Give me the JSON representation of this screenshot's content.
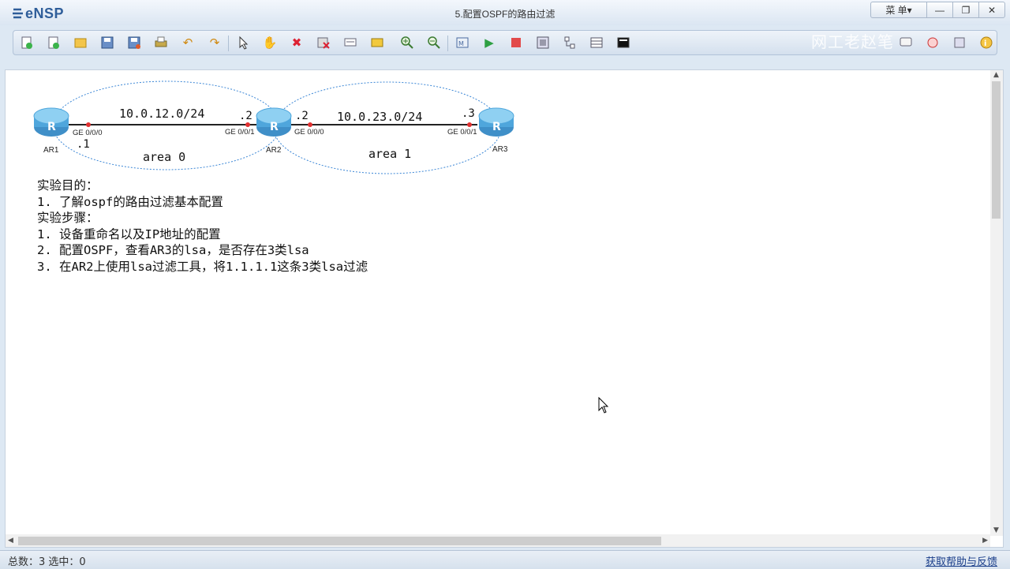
{
  "app": {
    "logo": "eNSP",
    "window_title": "5.配置OSPF的路由过滤",
    "menu_label": "菜 单▾",
    "minimize": "—",
    "restore": "❐",
    "close": "✕"
  },
  "watermark": "网工老赵笔",
  "toolbar": {
    "buttons": [
      "new-topology",
      "new-topology-alt",
      "open",
      "save",
      "save-as",
      "print",
      "undo",
      "redo",
      "select",
      "pan",
      "delete",
      "delete-links",
      "add-text",
      "add-shape",
      "zoom-in",
      "zoom-out",
      "fit",
      "start-devices",
      "stop-devices",
      "capture",
      "topo-view",
      "grid",
      "command-line",
      "chat",
      "settings",
      "register",
      "help"
    ]
  },
  "topology": {
    "devices": [
      {
        "name": "AR1"
      },
      {
        "name": "AR2"
      },
      {
        "name": "AR3"
      }
    ],
    "links": [
      {
        "subnet": "10.0.12.0/24",
        "left_port": "GE 0/0/0",
        "right_port": "GE 0/0/1",
        "left_ip": ".1",
        "right_ip": ".2"
      },
      {
        "subnet": "10.0.23.0/24",
        "left_port": "GE 0/0/0",
        "right_port": "GE 0/0/1",
        "left_ip": ".2",
        "right_ip": ".3"
      }
    ],
    "areas": [
      "area 0",
      "area 1"
    ],
    "accent_color": "#3c87d6"
  },
  "notes": [
    "实验目的：",
    "1. 了解ospf的路由过滤基本配置",
    "实验步骤：",
    "1. 设备重命名以及IP地址的配置",
    "2. 配置OSPF，查看AR3的lsa，是否存在3类lsa",
    "3. 在AR2上使用lsa过滤工具，将1.1.1.1这条3类lsa过滤"
  ],
  "statusbar": {
    "total_label": "总数：3",
    "selected_label": "选中：0",
    "help_link": "获取帮助与反馈"
  }
}
